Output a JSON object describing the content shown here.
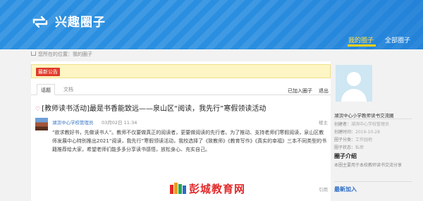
{
  "header": {
    "title": "兴趣圈子",
    "logo_icon": "sync-arrows-icon",
    "nav_mine": "我的圈子",
    "nav_all": "全部圈子",
    "accent": "#2a8fe0"
  },
  "breadcrumb": {
    "prefix": "您所在的位置：",
    "current": "我的圈子"
  },
  "notice": {
    "tag": "最新公告"
  },
  "tabs": [
    {
      "label": "话题",
      "active": true
    },
    {
      "label": "文档",
      "active": false
    }
  ],
  "actions": {
    "joined": "已加入圈子",
    "quit": "退出"
  },
  "post": {
    "title": "[教师读书活动]最是书香能致远——泉山区“阅读，我先行”寒假领读活动",
    "author": "湖滨中心学校管理员",
    "date": "03月02日 11:34",
    "floor": "楼主",
    "body": "“欲求教好书，先做读书人”。教师不仅要做真正的阅读者，更要做阅读的先行者。为了推动、支持老师们寒假阅读，泉山区教师发展中心特别推出2021“阅读，我先行”寒假领读活动，我校选择了《致教师》《教育写作》《真实的幸福》三本不同类型的书籍推荐给大家，希望老师们能多多分享读书感悟，放松身心、充实自己。",
    "quote": "引用"
  },
  "brand": {
    "text": "彭城教育网"
  },
  "side": {
    "group_name": "湖滨中心小学教师读书交流圈",
    "creator_label": "创建者：",
    "creator": "湖滨中心学校管理员",
    "created_label": "创建时间：",
    "created": "2019-10-28",
    "category_label": "圈子分类：",
    "category": "工作园地",
    "type_label": "圈子状态：",
    "type": "私密",
    "intro_heading": "圈子介绍",
    "intro": "本圈主要用于本校教师读书交流分享",
    "recent_heading": "最新加入"
  }
}
